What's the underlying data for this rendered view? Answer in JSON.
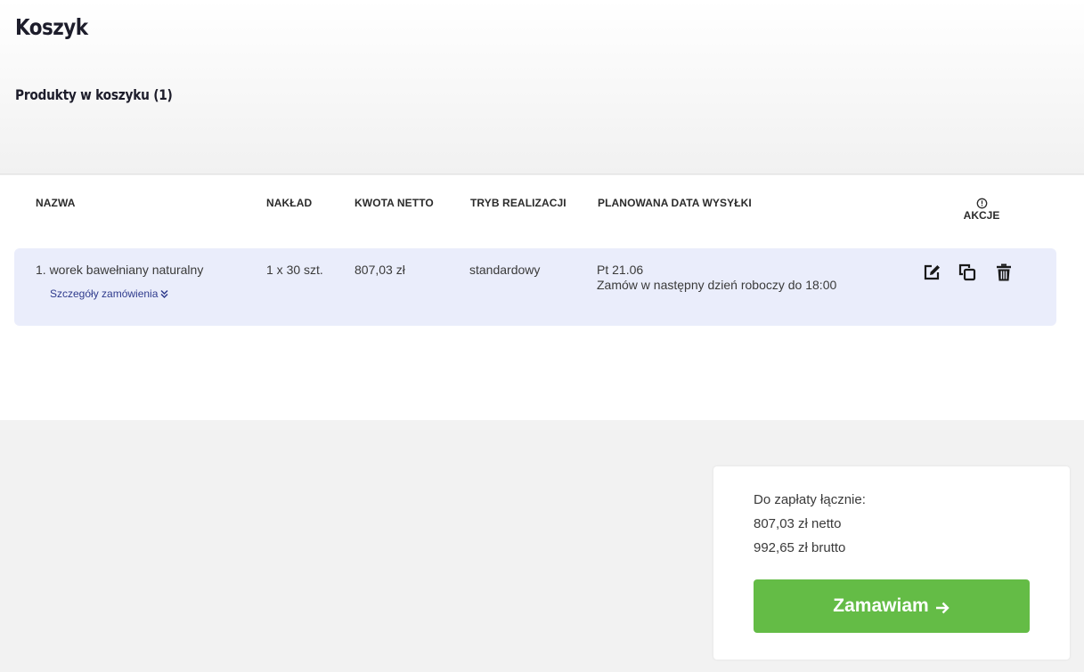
{
  "page": {
    "title": "Koszyk",
    "subtitle": "Produkty w koszyku (1)"
  },
  "table": {
    "headers": {
      "name": "NAZWA",
      "quantity": "NAKŁAD",
      "net_amount": "KWOTA NETTO",
      "mode": "TRYB REALIZACJI",
      "ship_date": "PLANOWANA DATA WYSYŁKI",
      "actions": "AKCJE"
    },
    "rows": [
      {
        "name": "1. worek bawełniany naturalny",
        "details_link": "Szczegóły zamówienia",
        "quantity": "1 x 30 szt.",
        "net_amount": "807,03 zł",
        "mode": "standardowy",
        "ship_date": "Pt 21.06",
        "ship_note": "Zamów w następny dzień roboczy do 18:00"
      }
    ]
  },
  "icons": {
    "header_info": "info-circle-icon",
    "details_toggle": "chevron-double-down-icon",
    "edit": "edit-icon",
    "copy": "copy-icon",
    "delete": "trash-icon",
    "order_arrow": "arrow-right-icon"
  },
  "summary": {
    "label": "Do zapłaty łącznie:",
    "net": "807,03 zł netto",
    "gross": "992,65 zł brutto",
    "order_button": "Zamawiam"
  },
  "colors": {
    "row_background": "#eaedfb",
    "link": "#2e3a8c",
    "order_button": "#64bc46"
  }
}
